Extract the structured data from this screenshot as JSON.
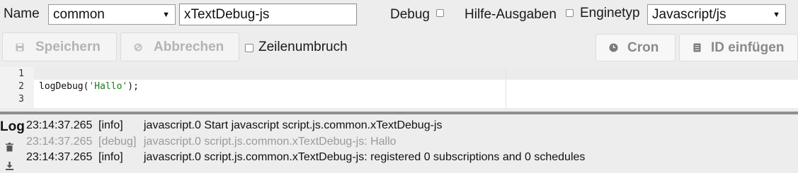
{
  "toolbar": {
    "name_label": "Name",
    "folder_value": "common",
    "script_name_value": "xTextDebug-js",
    "debug_label": "Debug",
    "hilfe_label": "Hilfe-Ausgaben",
    "enginetyp_label": "Enginetyp",
    "engine_value": "Javascript/js"
  },
  "actions": {
    "save_label": "Speichern",
    "cancel_label": "Abbrechen",
    "wrap_label": "Zeilenumbruch",
    "cron_label": "Cron",
    "insert_id_label": "ID einfügen"
  },
  "editor": {
    "line_numbers": [
      "1",
      "2",
      "3"
    ],
    "code_prefix": "logDebug(",
    "code_string": "'Hallo'",
    "code_suffix": ");"
  },
  "log": {
    "title": "Log",
    "entries": [
      {
        "time": "23:14:37.265",
        "level": "[info]",
        "message": "javascript.0 Start javascript script.js.common.xTextDebug-js"
      },
      {
        "time": "23:14:37.265",
        "level": "[debug]",
        "message": "javascript.0 script.js.common.xTextDebug-js: Hallo"
      },
      {
        "time": "23:14:37.265",
        "level": "[info]",
        "message": "javascript.0 script.js.common.xTextDebug-js: registered 0 subscriptions and 0 schedules"
      }
    ]
  },
  "icons": {
    "save": "floppy-icon",
    "cancel": "ban-icon",
    "cron": "clock-icon",
    "insert_id": "list-icon",
    "log_clear": "trash-icon",
    "log_download": "download-icon"
  }
}
